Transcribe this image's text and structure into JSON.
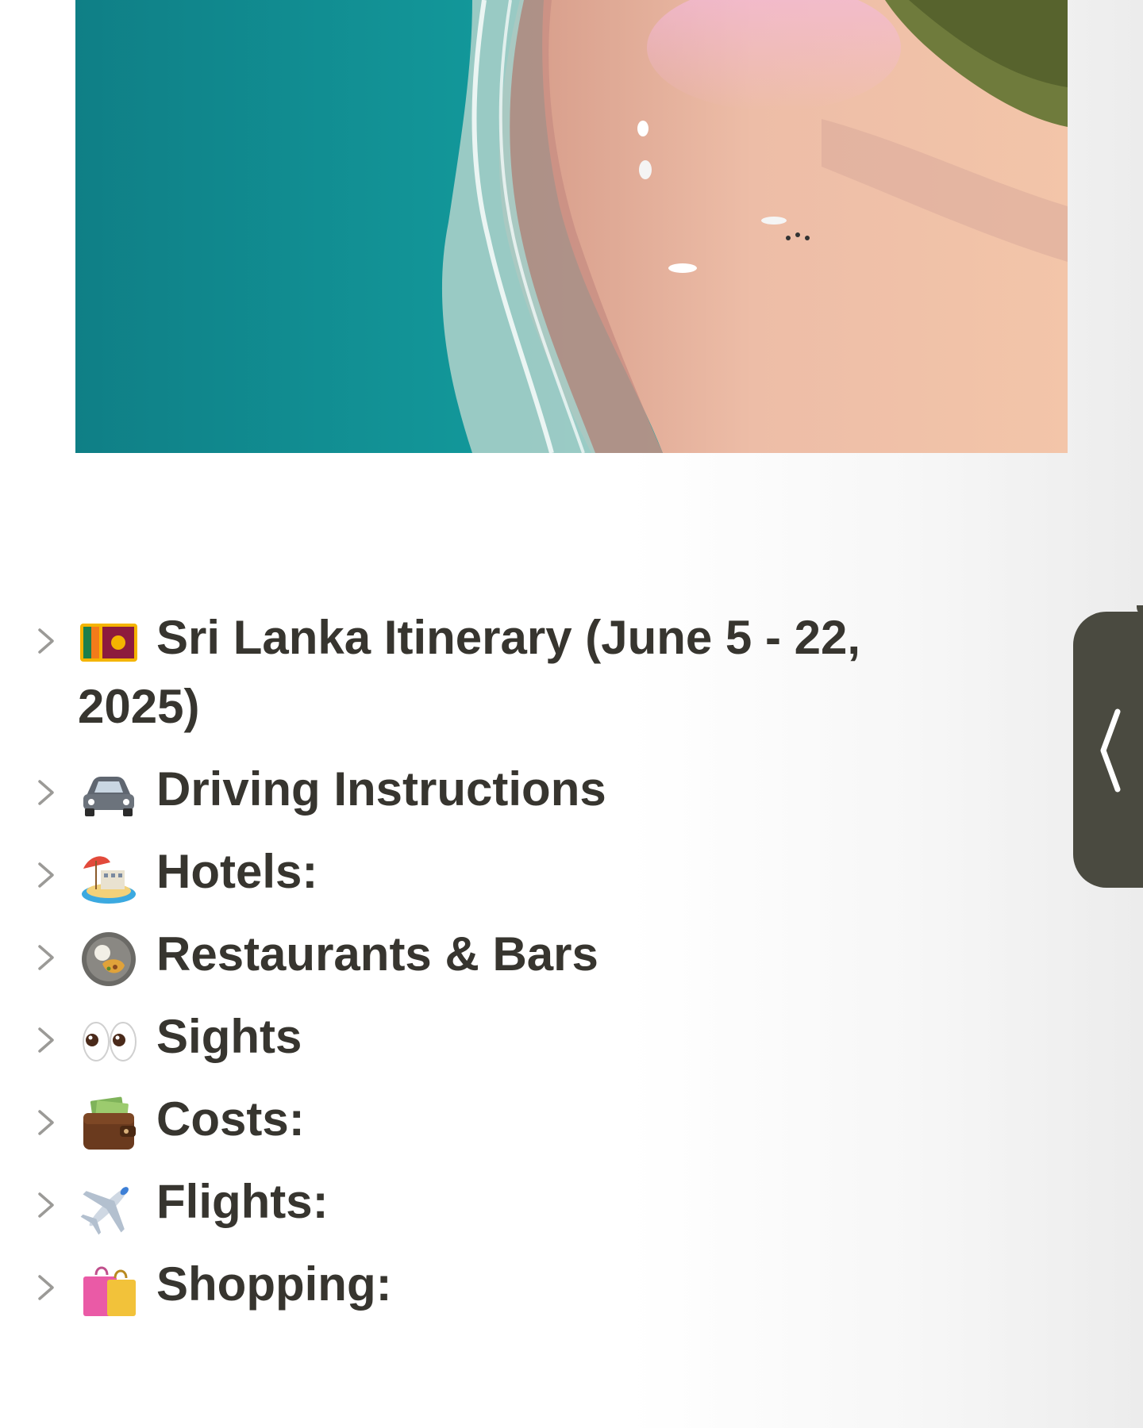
{
  "cover": {
    "description_icon": "beach-cover-image"
  },
  "toggles": [
    {
      "emoji_icon": "sri-lanka-flag-icon",
      "title_prefix": "Sri Lanka Itinerary (",
      "title_date_a": "June 5 - 22",
      "title_comma": ",",
      "title_date_b": "2025",
      "title_suffix": ")"
    },
    {
      "emoji_icon": "car-icon",
      "title": "Driving Instructions"
    },
    {
      "emoji_icon": "beach-hotel-icon",
      "title": "Hotels:"
    },
    {
      "emoji_icon": "food-plate-icon",
      "title": "Restaurants & Bars"
    },
    {
      "emoji_icon": "eyes-icon",
      "title": "Sights"
    },
    {
      "emoji_icon": "wallet-money-icon",
      "title": "Costs:"
    },
    {
      "emoji_icon": "airplane-icon",
      "title": "Flights:"
    },
    {
      "emoji_icon": "shopping-bags-icon",
      "title": "Shopping:"
    }
  ],
  "side_handle": {
    "icon": "chevron-left-icon"
  },
  "colors": {
    "text": "#37352f",
    "chevron": "#9b9a97",
    "handle": "#4a4a40"
  }
}
